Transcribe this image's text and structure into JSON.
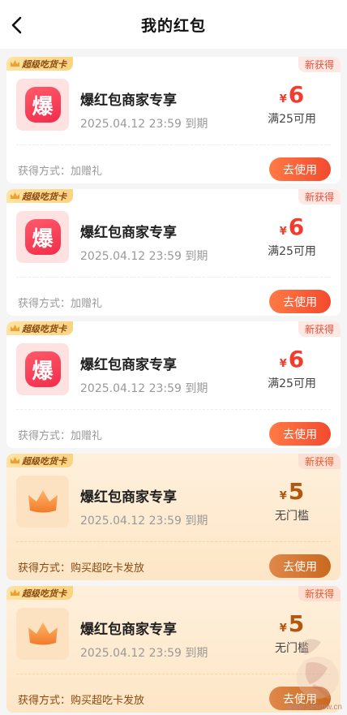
{
  "header": {
    "title": "我的红包"
  },
  "coupons": [
    {
      "tag": "超级吃货卡",
      "badge": "新获得",
      "icon_char": "爆",
      "name": "爆红包商家专享",
      "expire": "2025.04.12 23:59 到期",
      "currency": "¥",
      "amount": "6",
      "condition": "满25可用",
      "method": "获得方式：加赠礼",
      "button": "去使用",
      "style": "red"
    },
    {
      "tag": "超级吃货卡",
      "badge": "新获得",
      "icon_char": "爆",
      "name": "爆红包商家专享",
      "expire": "2025.04.12 23:59 到期",
      "currency": "¥",
      "amount": "6",
      "condition": "满25可用",
      "method": "获得方式：加赠礼",
      "button": "去使用",
      "style": "red"
    },
    {
      "tag": "超级吃货卡",
      "badge": "新获得",
      "icon_char": "爆",
      "name": "爆红包商家专享",
      "expire": "2025.04.12 23:59 到期",
      "currency": "¥",
      "amount": "6",
      "condition": "满25可用",
      "method": "获得方式：加赠礼",
      "button": "去使用",
      "style": "red"
    },
    {
      "tag": "超级吃货卡",
      "badge": "新获得",
      "icon_char": "crown-icon",
      "name": "爆红包商家专享",
      "expire": "2025.04.12 23:59 到期",
      "currency": "¥",
      "amount": "5",
      "condition": "无门槛",
      "method": "获得方式：购买超吃卡发放",
      "button": "去使用",
      "style": "gold"
    },
    {
      "tag": "超级吃货卡",
      "badge": "新获得",
      "icon_char": "crown-icon",
      "name": "爆红包商家专享",
      "expire": "2025.04.12 23:59 到期",
      "currency": "¥",
      "amount": "5",
      "condition": "无门槛",
      "method": "获得方式：购买超吃卡发放",
      "button": "去使用",
      "style": "gold"
    }
  ],
  "watermark": {
    "url": "www.5esmw.cn"
  }
}
